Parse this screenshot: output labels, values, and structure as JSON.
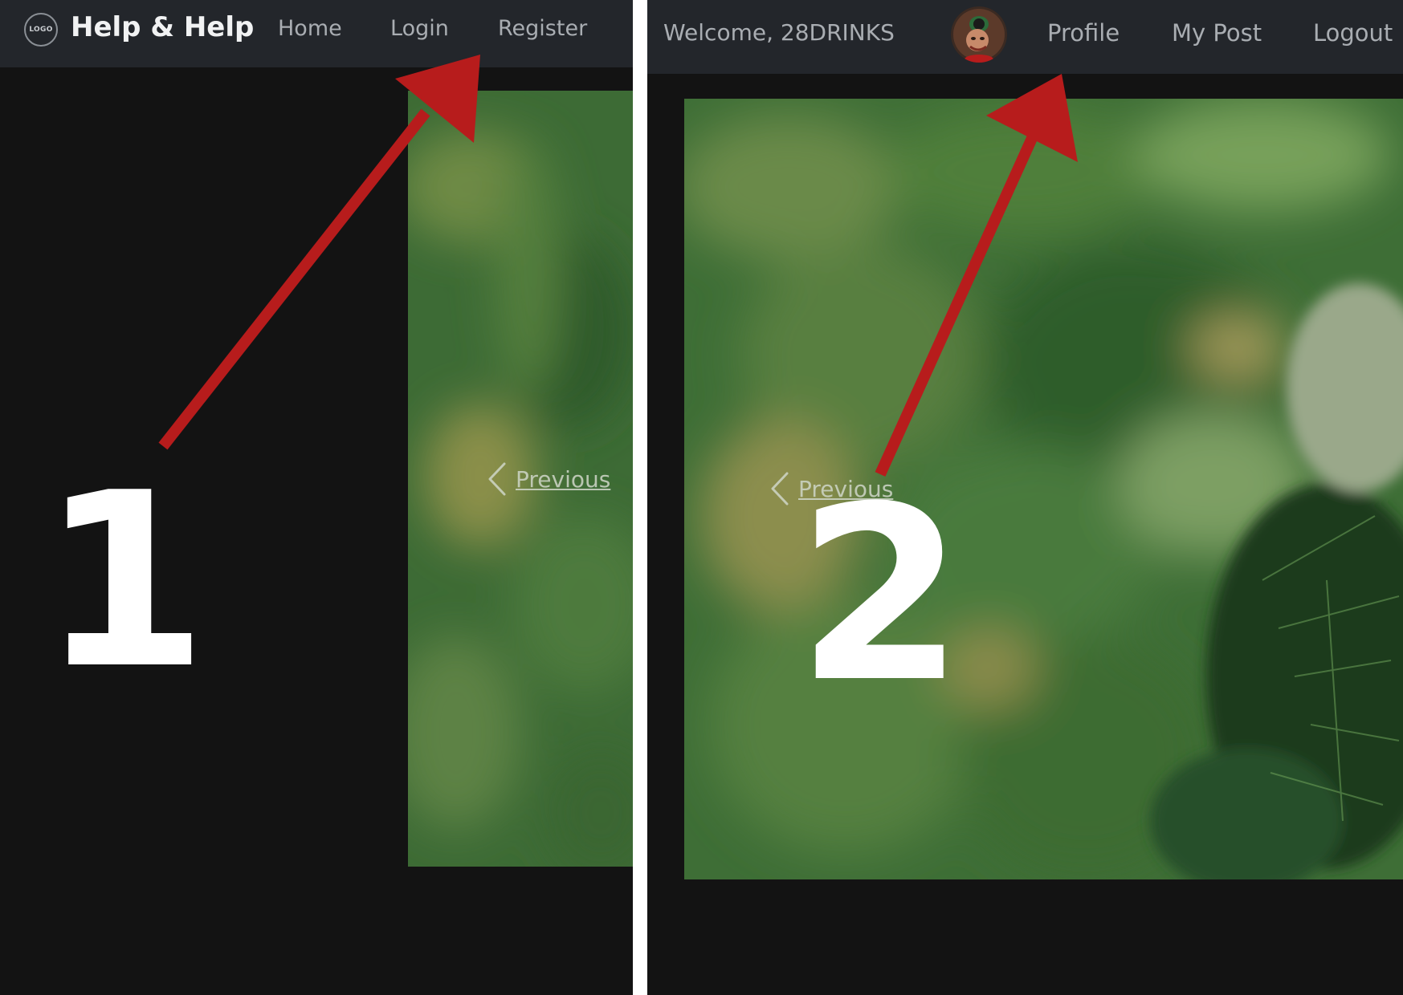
{
  "colors": {
    "navbar_bg": "#23262b",
    "page_bg": "#131313",
    "divider": "#ffffff",
    "arrow": "#b71c1c",
    "nav_text": "#a9adb2",
    "brand_text": "#f1f2f3"
  },
  "panel_1": {
    "step_number": "1",
    "navbar": {
      "logo_text": "LOGO",
      "brand": "Help & Help",
      "links": {
        "home": "Home",
        "login": "Login",
        "register": "Register"
      }
    },
    "carousel": {
      "previous_label": "Previous",
      "previous_icon": "chevron-left-icon"
    },
    "annotation": {
      "icon": "arrow-icon",
      "points_to": "Register"
    }
  },
  "panel_2": {
    "step_number": "2",
    "navbar": {
      "welcome": "Welcome, 28DRINKS",
      "avatar_icon": "user-avatar",
      "links": {
        "profile": "Profile",
        "my_post": "My Post",
        "logout": "Logout"
      }
    },
    "carousel": {
      "previous_label": "Previous",
      "previous_icon": "chevron-left-icon"
    },
    "annotation": {
      "icon": "arrow-icon",
      "points_to": "Profile"
    }
  }
}
